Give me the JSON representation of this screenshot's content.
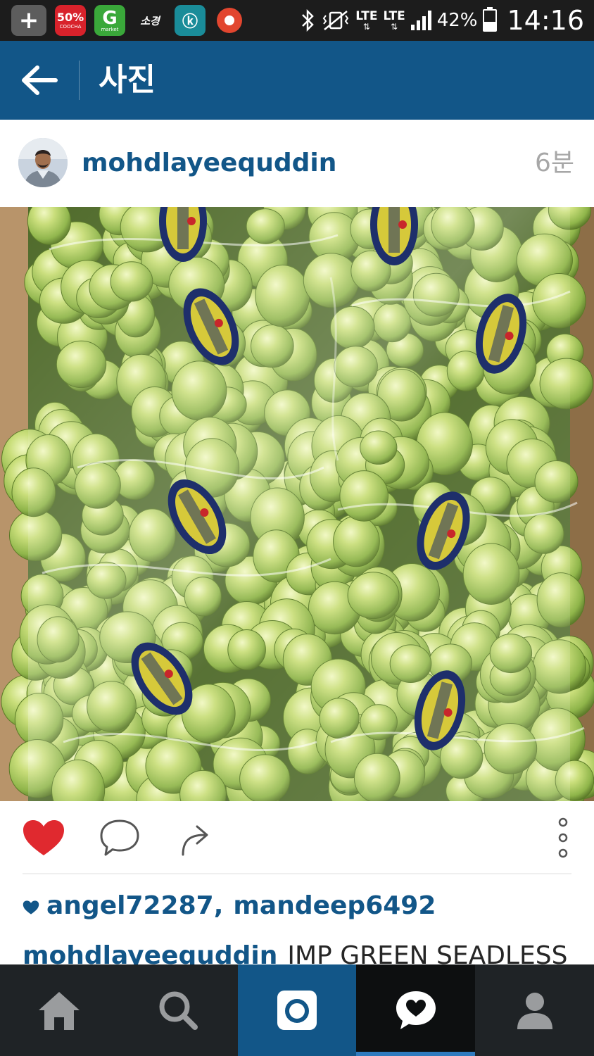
{
  "status_bar": {
    "apps": [
      {
        "name": "plus",
        "label": "+"
      },
      {
        "name": "coocha",
        "label": "50%",
        "sub": "COOCHA"
      },
      {
        "name": "gmarket",
        "label": "G",
        "sub": "market"
      },
      {
        "name": "sojung",
        "label": "소경"
      },
      {
        "name": "teal-app",
        "label": "ⓚ"
      },
      {
        "name": "recorder",
        "label": ""
      }
    ],
    "network_lte_1": "LTE",
    "network_lte_2": "LTE",
    "battery_percent": "42%",
    "battery_level": 0.42,
    "time": "14:16"
  },
  "header": {
    "title": "사진",
    "back_icon": "arrow-left-icon"
  },
  "post": {
    "username": "mohdlayeequddin",
    "timestamp": "6분",
    "liked": true,
    "likers": [
      "angel72287",
      "mandeep6492"
    ],
    "likers_separator": ",",
    "caption_user": "mohdlayeequddin",
    "caption_text": "IMP GREEN SEADLESS"
  },
  "icons": {
    "like": "heart-icon",
    "comment": "comment-bubble-icon",
    "share": "share-arrow-icon",
    "more": "more-vertical-icon"
  },
  "nav": {
    "tabs": [
      {
        "name": "home",
        "icon": "home-icon"
      },
      {
        "name": "search",
        "icon": "search-icon"
      },
      {
        "name": "camera",
        "icon": "camera-icon"
      },
      {
        "name": "activity",
        "icon": "activity-heart-icon"
      },
      {
        "name": "profile",
        "icon": "profile-icon"
      }
    ]
  },
  "colors": {
    "header": "#125688",
    "accent_text": "#125688",
    "like": "#e0292f",
    "nav_bg": "#1f2326"
  }
}
